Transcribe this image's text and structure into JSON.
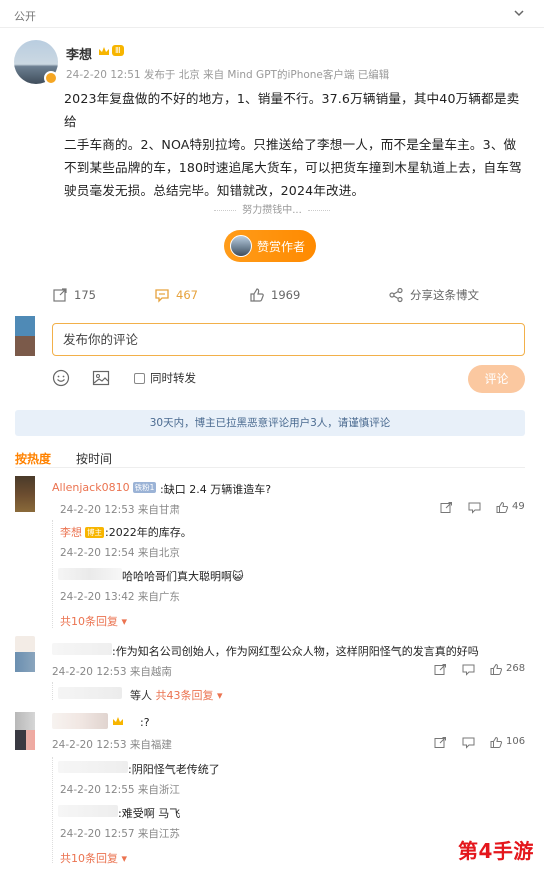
{
  "topbar": {
    "visibility": "公开"
  },
  "post": {
    "author": "李想",
    "vip_level": "Ⅲ",
    "meta": "24-2-20 12:51  发布于 北京  来自 Mind GPT的iPhone客户端  已编辑",
    "lines": [
      "2023年复盘做的不好的地方，1、销量不行。37.6万辆销量，其中40万辆都是卖给",
      "二手车商的。2、NOA特别拉垮。只推送给了李想一人，而不是全量车主。3、做",
      "不到某些品牌的车，180时速追尾大货车，可以把货车撞到木星轨道上去，自车驾",
      "驶员毫发无损。总结完毕。知错就改，2024年改进。"
    ],
    "divider": "努力攒钱中...",
    "reward_label": "赞赏作者"
  },
  "actions": {
    "repost": "175",
    "comment": "467",
    "like": "1969",
    "share": "分享这条博文"
  },
  "compose": {
    "placeholder": "发布你的评论",
    "repost_check": "同时转发",
    "submit": "评论"
  },
  "notice": "30天内，博主已拉黑恶意评论用户3人，请谨慎评论",
  "sort": {
    "hot": "按热度",
    "time": "按时间"
  },
  "comments": [
    {
      "user": "Allenjack0810",
      "badge": "铁粉1",
      "text": ":缺口 2.4 万辆谁造车?",
      "meta": "24-2-20 12:53  来自甘肃",
      "likes": "49",
      "replies": [
        {
          "user": "李想",
          "badge": "博主",
          "text": ":2022年的库存。",
          "meta": "24-2-20 12:54  来自北京"
        },
        {
          "user": "",
          "text": "哈哈哈哥们真大聪明啊😺",
          "meta": "24-2-20 13:42  来自广东"
        }
      ],
      "more": "共10条回复"
    },
    {
      "user": "",
      "text": ":作为知名公司创始人，作为网红型公众人物，这样阴阳怪气的发言真的好吗",
      "meta": "24-2-20 12:53  来自越南",
      "likes": "268",
      "more_prefix": "等人",
      "more": "共43条回复"
    },
    {
      "user": "",
      "text": ":?",
      "meta": "24-2-20 12:53  来自福建",
      "likes": "106",
      "replies": [
        {
          "user": "",
          "text": ":阴阳怪气老传统了",
          "meta": "24-2-20 12:55  来自浙江"
        },
        {
          "user": "",
          "text": ":难受啊 马飞",
          "meta": "24-2-20 12:57  来自江苏"
        }
      ],
      "more": "共10条回复"
    }
  ],
  "watermark": "第4手游"
}
